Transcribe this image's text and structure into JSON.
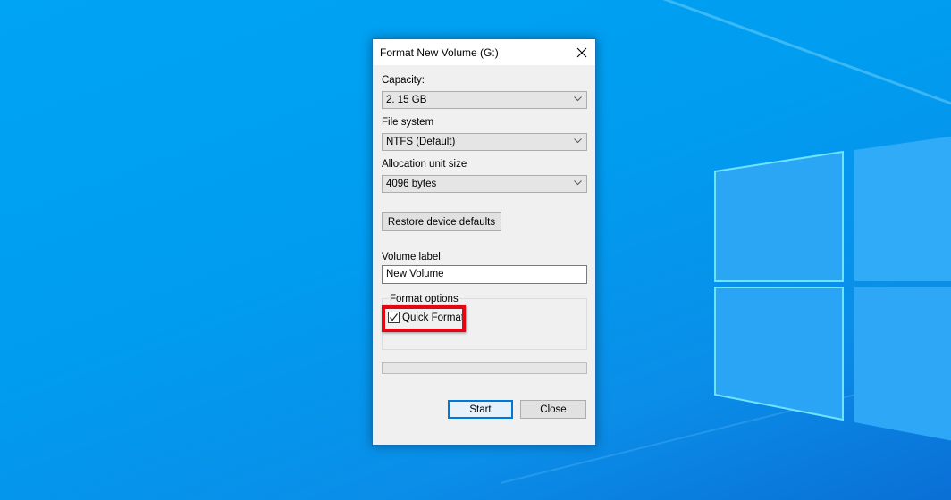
{
  "dialog": {
    "title": "Format New Volume (G:)",
    "close_icon": "close-icon",
    "capacity": {
      "label": "Capacity:",
      "value": "2. 15 GB"
    },
    "file_system": {
      "label": "File system",
      "value": "NTFS (Default)"
    },
    "allocation_unit": {
      "label": "Allocation unit size",
      "value": "4096 bytes"
    },
    "restore_defaults_label": "Restore device defaults",
    "volume_label": {
      "label": "Volume label",
      "value": "New Volume"
    },
    "format_options": {
      "legend": "Format options",
      "quick_format": {
        "label": "Quick Format",
        "checked": true
      }
    },
    "progress": {
      "fraction": 0
    },
    "start_label": "Start",
    "close_label": "Close"
  },
  "annotation": {
    "highlight_color": "#e30613",
    "target": "Quick Format"
  },
  "colors": {
    "accent": "#0078d7",
    "desktop": "#009cf0"
  }
}
